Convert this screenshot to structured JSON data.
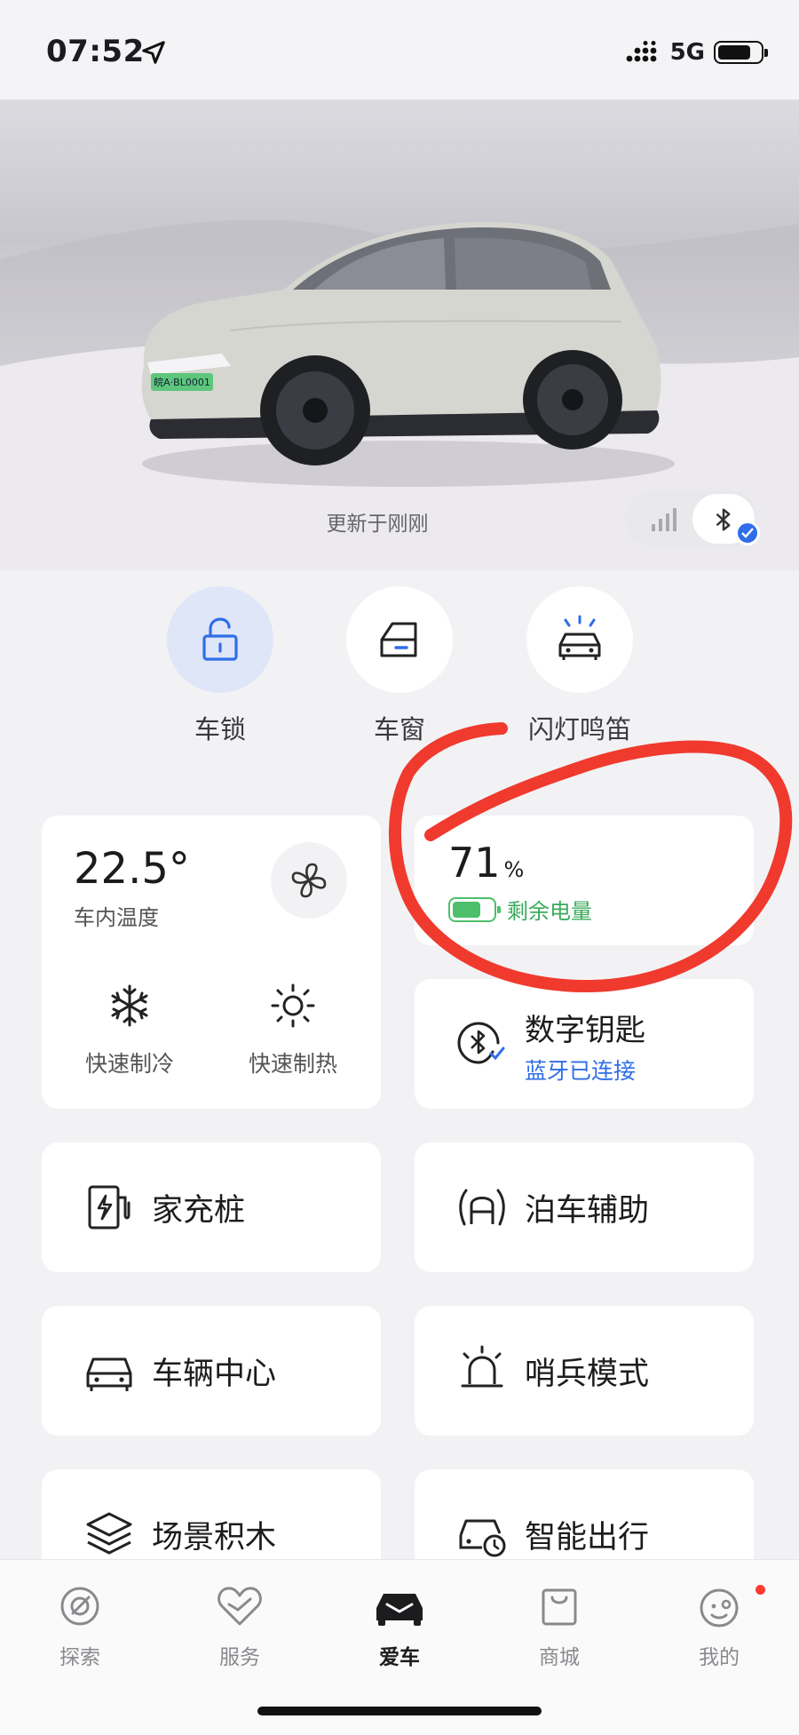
{
  "status_bar": {
    "time": "07:52",
    "network": "5G"
  },
  "hero": {
    "updated_text": "更新于刚刚",
    "license_plate": "皖A·BL0001"
  },
  "quick_controls": [
    {
      "label": "车锁",
      "icon": "lock-open-icon"
    },
    {
      "label": "车窗",
      "icon": "car-window-icon"
    },
    {
      "label": "闪灯鸣笛",
      "icon": "flash-horn-icon"
    }
  ],
  "climate": {
    "temperature": "22.5°",
    "temperature_label": "车内温度",
    "cool_label": "快速制冷",
    "heat_label": "快速制热"
  },
  "battery": {
    "value": "71",
    "unit": "%",
    "label": "剩余电量",
    "level": 0.71
  },
  "digital_key": {
    "title": "数字钥匙",
    "status": "蓝牙已连接"
  },
  "tiles": {
    "home_charger": "家充桩",
    "parking_assist": "泊车辅助",
    "vehicle_center": "车辆中心",
    "sentry_mode": "哨兵模式",
    "scene_blocks": "场景积木",
    "smart_travel": "智能出行"
  },
  "tabbar": [
    {
      "label": "探索",
      "icon": "explore-icon"
    },
    {
      "label": "服务",
      "icon": "service-icon"
    },
    {
      "label": "爱车",
      "icon": "my-car-icon",
      "active": true
    },
    {
      "label": "商城",
      "icon": "shop-icon"
    },
    {
      "label": "我的",
      "icon": "profile-icon"
    }
  ],
  "colors": {
    "accent_blue": "#2f6ee8",
    "battery_green": "#4bbf6b",
    "annotation_red": "#f03a2e"
  }
}
